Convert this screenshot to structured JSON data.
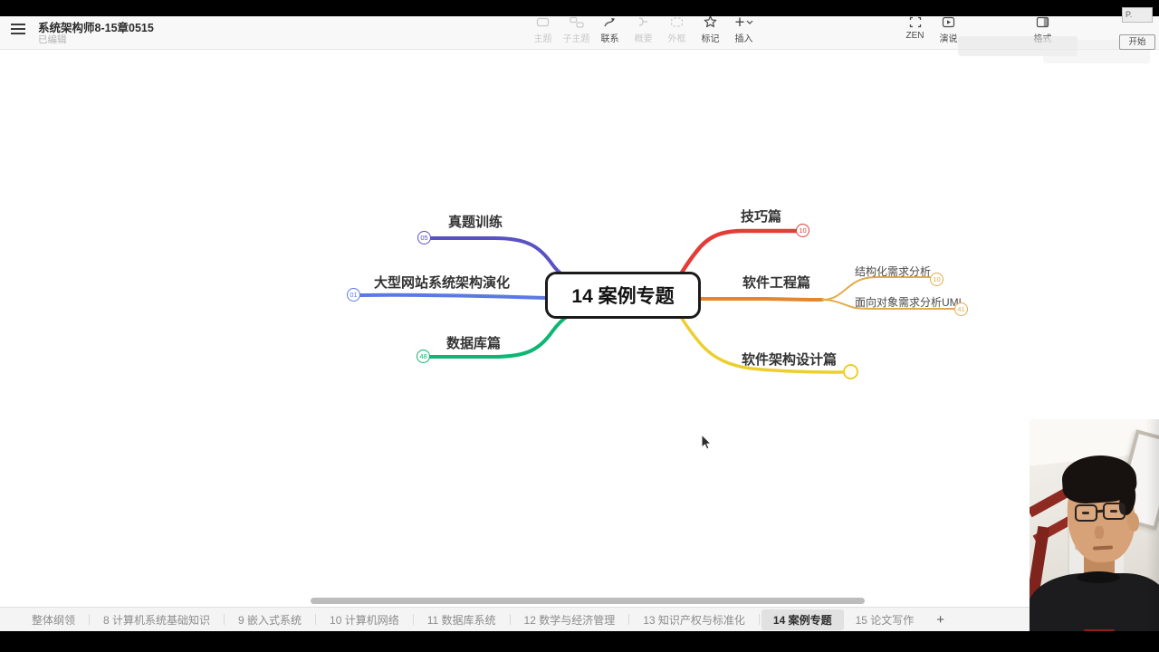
{
  "app": {
    "title": "系统架构师8-15章0515",
    "status": "已编辑"
  },
  "toolbar": {
    "items": [
      {
        "label": "主题",
        "enabled": false
      },
      {
        "label": "子主题",
        "enabled": false
      },
      {
        "label": "联系",
        "enabled": true
      },
      {
        "label": "概要",
        "enabled": false
      },
      {
        "label": "外框",
        "enabled": false
      },
      {
        "label": "标记",
        "enabled": true
      },
      {
        "label": "插入",
        "enabled": true
      }
    ],
    "right_items": [
      "ZEN",
      "演说",
      "格式"
    ]
  },
  "recorder": {
    "field_value": "P.",
    "start_label": "开始"
  },
  "mindmap": {
    "root_label": "14 案例专题",
    "branches": [
      {
        "label": "真题训练",
        "badge": "05",
        "color": "#5a52c4",
        "side": "left"
      },
      {
        "label": "大型网站系统架构演化",
        "badge": "01",
        "color": "#5b79e3",
        "side": "left"
      },
      {
        "label": "数据库篇",
        "badge": "48",
        "color": "#0cb673",
        "side": "left"
      },
      {
        "label": "技巧篇",
        "badge": "10",
        "color": "#e23d38",
        "side": "right"
      },
      {
        "label": "软件工程篇",
        "badge": "",
        "color": "#e5862e",
        "side": "right",
        "children": [
          {
            "label": "结构化需求分析",
            "badge": "10",
            "color": "#e3aa4e"
          },
          {
            "label": "面向对象需求分析UML",
            "badge": "41",
            "color": "#e3aa4e"
          }
        ]
      },
      {
        "label": "软件架构设计篇",
        "badge": "",
        "color": "#eccf2e",
        "side": "right"
      }
    ]
  },
  "sheets": {
    "tabs": [
      {
        "label": "整体纲领"
      },
      {
        "label": "8 计算机系统基础知识"
      },
      {
        "label": "9 嵌入式系统"
      },
      {
        "label": "10 计算机网络"
      },
      {
        "label": "11 数据库系统"
      },
      {
        "label": "12 数学与经济管理"
      },
      {
        "label": "13 知识产权与标准化"
      },
      {
        "label": "14 案例专题",
        "active": true
      },
      {
        "label": "15 论文写作"
      }
    ],
    "add_label": "+"
  }
}
